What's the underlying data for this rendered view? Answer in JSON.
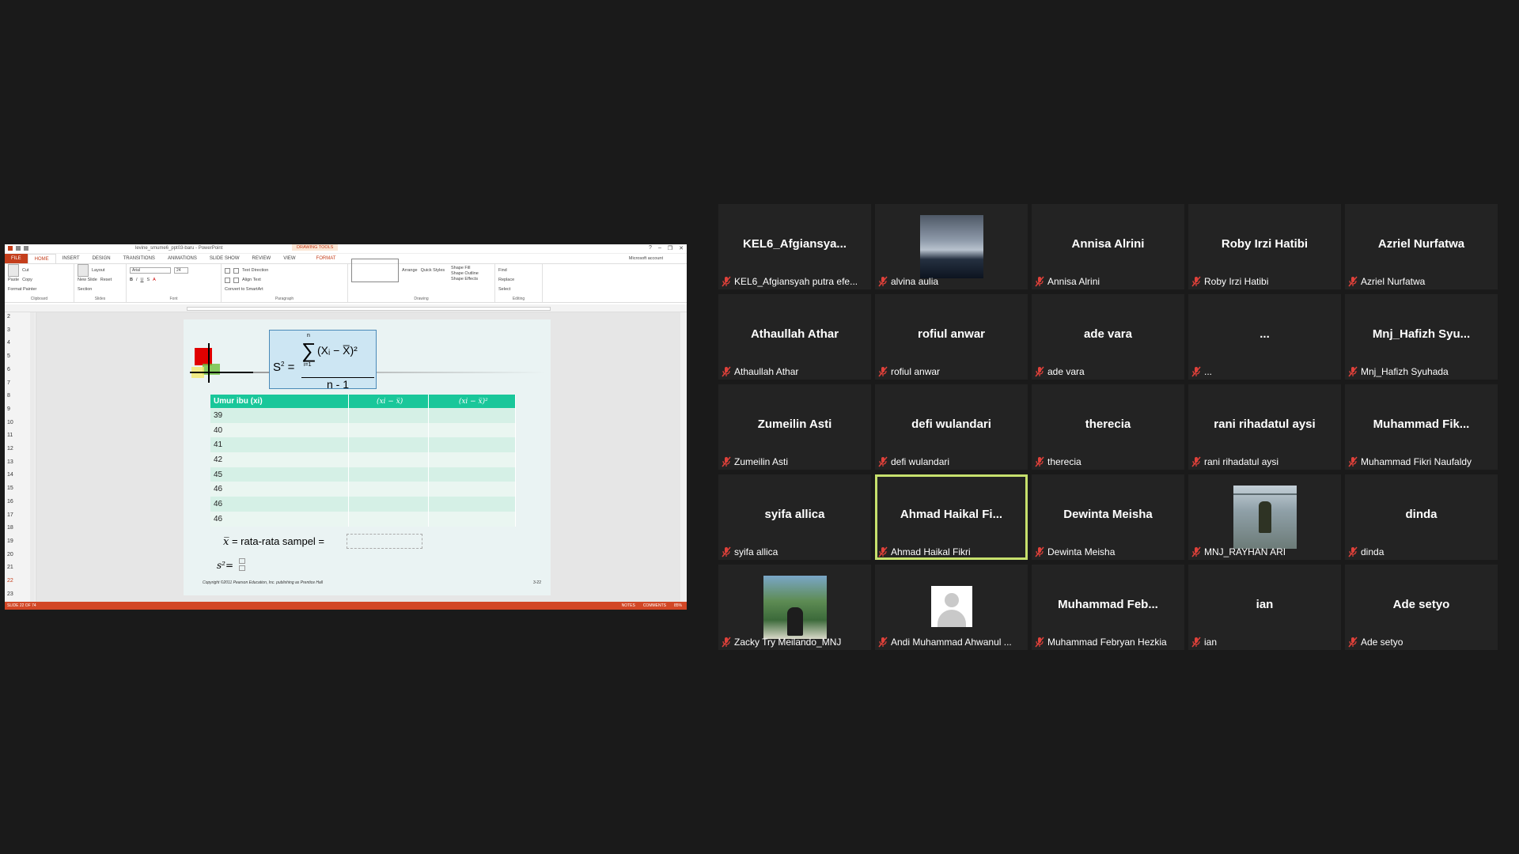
{
  "powerpoint": {
    "window_title": "levine_smume6_ppt03-baru - PowerPoint",
    "drawing_tools": "DRAWING TOOLS",
    "tabs": [
      "FILE",
      "HOME",
      "INSERT",
      "DESIGN",
      "TRANSITIONS",
      "ANIMATIONS",
      "SLIDE SHOW",
      "REVIEW",
      "VIEW",
      "FORMAT"
    ],
    "account": "Microsoft account",
    "ribbon": {
      "clipboard": {
        "label": "Clipboard",
        "paste": "Paste",
        "cut": "Cut",
        "copy": "Copy",
        "format_painter": "Format Painter"
      },
      "slides": {
        "label": "Slides",
        "new_slide": "New Slide",
        "layout": "Layout",
        "reset": "Reset",
        "section": "Section"
      },
      "font": {
        "label": "Font",
        "name": "Arial",
        "size": "24"
      },
      "paragraph": {
        "label": "Paragraph",
        "text_direction": "Text Direction",
        "align_text": "Align Text",
        "smartart": "Convert to SmartArt"
      },
      "drawing": {
        "label": "Drawing",
        "arrange": "Arrange",
        "quick_styles": "Quick Styles",
        "shape_fill": "Shape Fill",
        "shape_outline": "Shape Outline",
        "shape_effects": "Shape Effects"
      },
      "editing": {
        "label": "Editing",
        "find": "Find",
        "replace": "Replace",
        "select": "Select"
      }
    },
    "slide_numbers": [
      "2",
      "3",
      "4",
      "5",
      "6",
      "7",
      "8",
      "9",
      "10",
      "11",
      "12",
      "13",
      "14",
      "15",
      "16",
      "17",
      "18",
      "19",
      "20",
      "21",
      "22",
      "23"
    ],
    "selected_slide": "22",
    "status": {
      "slide_of": "SLIDE 22 OF 74",
      "notes": "NOTES",
      "comments": "COMMENTS",
      "zoom": "85%"
    },
    "slide": {
      "formula": {
        "lhs": "S",
        "lhs_sup": "2",
        "eq": "=",
        "upper": "n",
        "lower": "i=1",
        "numerator": "(Xᵢ − X̅)²",
        "denominator": "n - 1"
      },
      "table": {
        "headers": [
          "Umur ibu (xi)",
          "(xi − x̅)",
          "(xi − x̅)²"
        ],
        "rows": [
          "39",
          "40",
          "41",
          "42",
          "45",
          "46",
          "46",
          "46"
        ]
      },
      "mean_text": "= rata-rata sampel =",
      "mean_symbol": "x̅",
      "s2_text": "s²=",
      "copyright": "Copyright ©2011 Pearson Education, Inc. publishing as Prentice Hall",
      "page": "3-22"
    }
  },
  "participants": [
    {
      "display": "KEL6_Afgiansya...",
      "name": "KEL6_Afgiansyah putra efe...",
      "video": null
    },
    {
      "display": "",
      "name": "alvina aulia",
      "video": "sky"
    },
    {
      "display": "Annisa Alrini",
      "name": "Annisa Alrini",
      "video": null
    },
    {
      "display": "Roby Irzi Hatibi",
      "name": "Roby Irzi Hatibi",
      "video": null
    },
    {
      "display": "Azriel Nurfatwa",
      "name": "Azriel Nurfatwa",
      "video": null
    },
    {
      "display": "Athaullah Athar",
      "name": "Athaullah Athar",
      "video": null
    },
    {
      "display": "rofiul anwar",
      "name": "rofiul anwar",
      "video": null
    },
    {
      "display": "ade vara",
      "name": "ade vara",
      "video": null
    },
    {
      "display": "...",
      "name": "...",
      "video": null
    },
    {
      "display": "Mnj_Hafizh  Syu...",
      "name": "Mnj_Hafizh Syuhada",
      "video": null
    },
    {
      "display": "Zumeilin Asti",
      "name": "Zumeilin Asti",
      "video": null
    },
    {
      "display": "defi wulandari",
      "name": "defi wulandari",
      "video": null
    },
    {
      "display": "therecia",
      "name": "therecia",
      "video": null
    },
    {
      "display": "rani rihadatul aysi",
      "name": "rani rihadatul aysi",
      "video": null
    },
    {
      "display": "Muhammad  Fik...",
      "name": "Muhammad Fikri Naufaldy",
      "video": null
    },
    {
      "display": "syifa allica",
      "name": "syifa allica",
      "video": null
    },
    {
      "display": "Ahmad  Haikal  Fi...",
      "name": "Ahmad Haikal Fikri",
      "video": null,
      "active": true
    },
    {
      "display": "Dewinta Meisha",
      "name": "Dewinta Meisha",
      "video": null
    },
    {
      "display": "",
      "name": "MNJ_RAYHAN ARI",
      "video": "walk"
    },
    {
      "display": "dinda",
      "name": "dinda",
      "video": null
    },
    {
      "display": "",
      "name": "Zacky Try Meilando_MNJ",
      "video": "land"
    },
    {
      "display": "",
      "name": "Andi Muhammad Ahwanul ...",
      "video": "avatar"
    },
    {
      "display": "Muhammad  Feb...",
      "name": "Muhammad Febryan Hezkia",
      "video": null
    },
    {
      "display": "ian",
      "name": "ian",
      "video": null
    },
    {
      "display": "Ade setyo",
      "name": "Ade setyo",
      "video": null
    }
  ],
  "colors": {
    "active_speaker": "#c6e06d",
    "mic_muted": "#e0413a",
    "ppt_accent": "#c43e1c",
    "table_header": "#19c79a"
  }
}
